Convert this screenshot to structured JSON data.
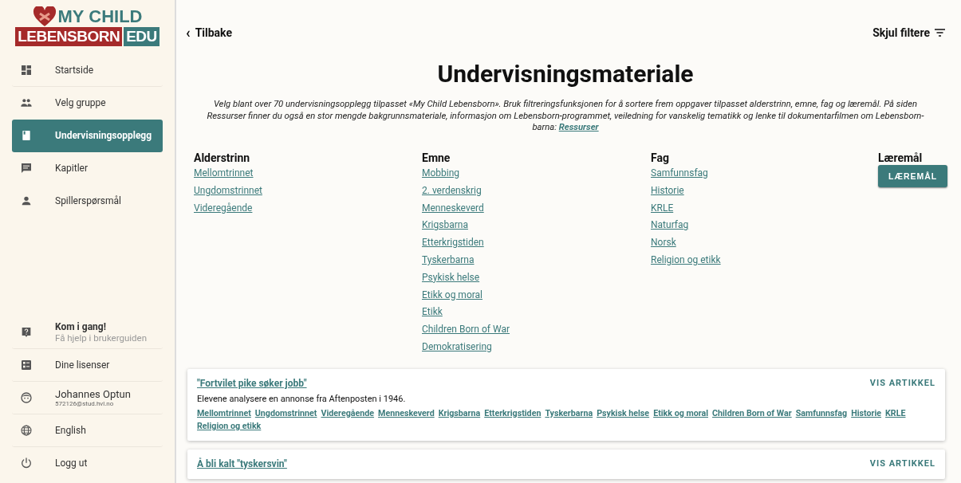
{
  "logo": {
    "line1": "MY CHILD",
    "line2": "LEBENSBORN",
    "badge": "EDU"
  },
  "sidebar": {
    "items": [
      {
        "label": "Startside",
        "selected": false
      },
      {
        "label": "Velg gruppe",
        "selected": false
      },
      {
        "label": "Undervisningsopplegg",
        "selected": true
      },
      {
        "label": "Kapitler",
        "selected": false
      },
      {
        "label": "Spillerspørsmål",
        "selected": false
      }
    ],
    "bottom_items": [
      {
        "kind": "help",
        "label": "Kom i gang!",
        "subtitle": "Få hjelp i brukerguiden"
      },
      {
        "kind": "plain",
        "label": "Dine lisenser"
      },
      {
        "kind": "user",
        "label": "Johannes Optun",
        "subtitle": "572126@stud.hvl.no"
      },
      {
        "kind": "plain",
        "label": "English"
      },
      {
        "kind": "plain",
        "label": "Logg ut"
      }
    ]
  },
  "back_link": "Tilbake",
  "back_icon": "‹",
  "hide_filters": "Skjul filtere",
  "title": "Undervisningsmateriale",
  "intro": {
    "text": "Velg blant over 70 undervisningsopplegg tilpasset «My Child Lebensborn». Bruk filtreringsfunksjonen for å sortere frem oppgaver tilpasset alderstrinn, emne, fag og læremål. På siden Ressurser finner du også en stor mengde bakgrunnsmateriale, informasjon om Lebensborn-programmet, veiledning for vanskelig tematikk og lenke til dokumentarfilmen om Lebensborn-barna:",
    "link": "Ressurser"
  },
  "filters": [
    {
      "heading": "Alderstrinn",
      "kind": "links",
      "items": [
        "Mellomtrinnet",
        "Ungdomstrinnet",
        "Videregående"
      ]
    },
    {
      "heading": "Emne",
      "kind": "links",
      "items": [
        "Mobbing",
        "2. verdenskrig",
        "Menneskeverd",
        "Krigsbarna",
        "Etterkrigstiden",
        "Tyskerbarna",
        "Psykisk helse",
        "Etikk og moral",
        "Etikk",
        "Children Born of War",
        "Demokratisering"
      ]
    },
    {
      "heading": "Fag",
      "kind": "links",
      "items": [
        "Samfunnsfag",
        "Historie",
        "KRLE",
        "Naturfag",
        "Norsk",
        "Religion og etikk"
      ]
    },
    {
      "heading": "Læremål",
      "kind": "button",
      "items": [
        "LÆREMÅL"
      ]
    }
  ],
  "articles": [
    {
      "title": "\"Fortvilet pike søker jobb\"",
      "description": "Elevene analysere en annonse fra Aftenposten i 1946.",
      "action": "VIS ARTIKKEL",
      "tags": [
        "Mellomtrinnet",
        "Ungdomstrinnet",
        "Videregående",
        "Menneskeverd",
        "Krigsbarna",
        "Etterkrigstiden",
        "Tyskerbarna",
        "Psykisk helse",
        "Etikk og moral",
        "Children Born of War",
        "Samfunnsfag",
        "Historie",
        "KRLE",
        "Religion og etikk"
      ]
    },
    {
      "title": "Å bli kalt \"tyskersvin\"",
      "action": "VIS ARTIKKEL"
    }
  ]
}
